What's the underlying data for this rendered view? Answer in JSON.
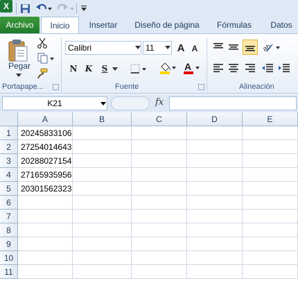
{
  "quick_access": {
    "logo_letter": "X",
    "icons": [
      "excel-logo",
      "save-icon",
      "undo-icon",
      "redo-icon",
      "customize-qat-icon"
    ]
  },
  "tabs": [
    {
      "id": "file",
      "label": "Archivo"
    },
    {
      "id": "home",
      "label": "Inicio",
      "selected": true
    },
    {
      "id": "insert",
      "label": "Insertar"
    },
    {
      "id": "layout",
      "label": "Diseño de página"
    },
    {
      "id": "formulas",
      "label": "Fórmulas"
    },
    {
      "id": "data",
      "label": "Datos"
    }
  ],
  "ribbon": {
    "clipboard": {
      "group_label": "Portapape...",
      "paste_label": "Pegar"
    },
    "font": {
      "group_label": "Fuente",
      "font_name": "Calibri",
      "font_size": "11",
      "bold": "N",
      "italic": "K",
      "underline": "S",
      "font_color_letter": "A",
      "grow_font": "A",
      "shrink_font": "A"
    },
    "alignment": {
      "group_label": "Alineación"
    }
  },
  "formula_bar": {
    "name_box": "K21",
    "fx_label": "fx",
    "formula": ""
  },
  "sheet": {
    "columns": [
      "A",
      "B",
      "C",
      "D",
      "E"
    ],
    "rows": [
      "1",
      "2",
      "3",
      "4",
      "5",
      "6",
      "7",
      "8",
      "9",
      "10",
      "11"
    ],
    "cells_a": [
      "20245833106",
      "27254014643",
      "20288027154",
      "27165935956",
      "20301562323",
      "",
      "",
      "",
      "",
      "",
      ""
    ]
  },
  "colors": {
    "file_tab": "#2b8a36",
    "ribbon_bg": "#dfe9f5",
    "fill_yellow": "#ffd700",
    "font_red": "#e00000"
  }
}
